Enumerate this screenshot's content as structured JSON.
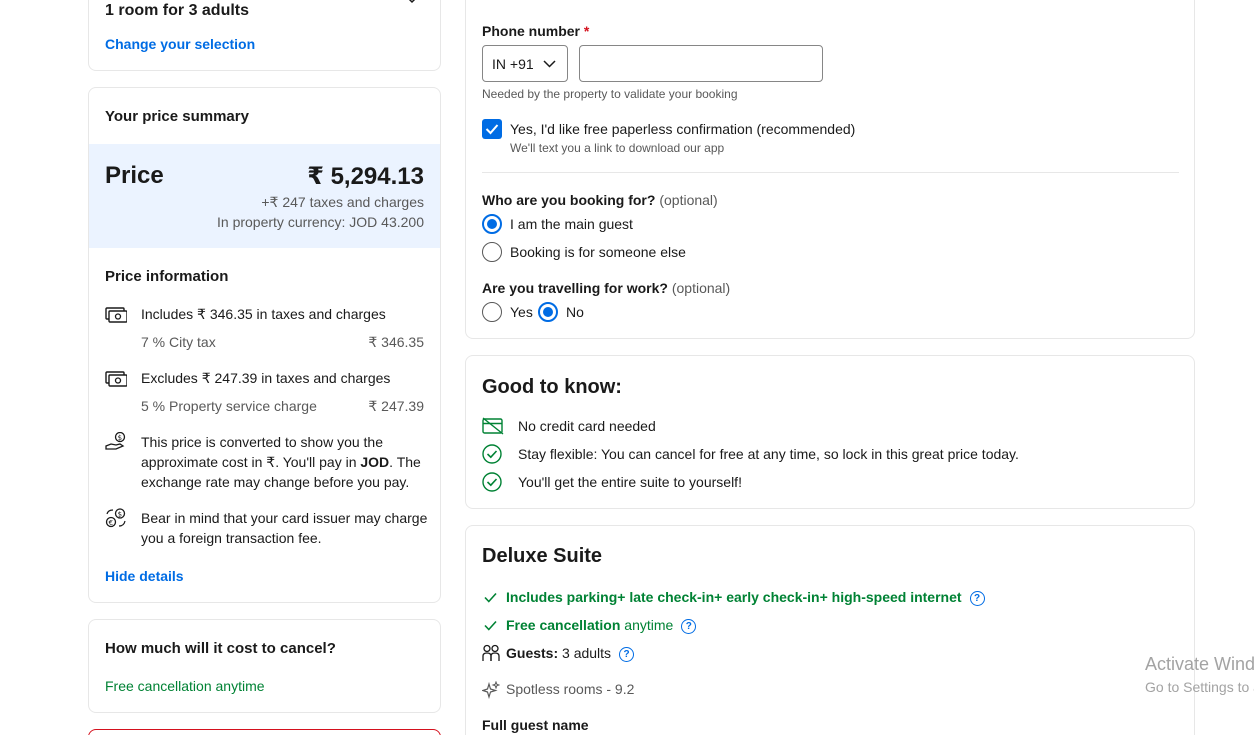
{
  "room_selection": {
    "title": "1 room for 3 adults",
    "change_link": "Change your selection"
  },
  "price_summary": {
    "heading": "Your price summary",
    "price_label": "Price",
    "price_value": "₹ 5,294.13",
    "taxes_line": "+₹ 247 taxes and charges",
    "property_currency": "In property currency: JOD 43.200"
  },
  "price_information": {
    "heading": "Price information",
    "includes_text": "Includes ₹ 346.35 in taxes and charges",
    "city_tax_label": "7 % City tax",
    "city_tax_value": "₹ 346.35",
    "excludes_text": "Excludes ₹ 247.39 in taxes and charges",
    "service_charge_label": "5 % Property service charge",
    "service_charge_value": "₹ 247.39",
    "converted_prefix": "This price is converted to show you the approximate cost in ₹. You'll pay in ",
    "converted_currency": "JOD",
    "converted_suffix": ". The exchange rate may change before you pay.",
    "card_fee_text": "Bear in mind that your card issuer may charge you a foreign transaction fee.",
    "hide_details": "Hide details"
  },
  "cancel_cost": {
    "heading": "How much will it cost to cancel?",
    "text": "Free cancellation anytime"
  },
  "form": {
    "phone_label": "Phone number",
    "required_mark": "*",
    "country_code": "IN +91",
    "phone_value": "",
    "phone_hint": "Needed by the property to validate your booking",
    "paperless_label": "Yes, I'd like free paperless confirmation (recommended)",
    "paperless_checked": true,
    "paperless_hint": "We'll text you a link to download our app",
    "booking_for_question": "Who are you booking for?",
    "booking_for_optional": "(optional)",
    "booking_for_options": [
      "I am the main guest",
      "Booking is for someone else"
    ],
    "booking_for_selected": "I am the main guest",
    "work_question": "Are you travelling for work?",
    "work_optional": "(optional)",
    "work_options": [
      "Yes",
      "No"
    ],
    "work_selected": "No"
  },
  "good_to_know": {
    "heading": "Good to know:",
    "items": [
      "No credit card needed",
      "Stay flexible: You can cancel for free at any time, so lock in this great price today.",
      "You'll get the entire suite to yourself!"
    ]
  },
  "suite": {
    "title": "Deluxe Suite",
    "includes": "Includes parking+ late check-in+ early check-in+ high-speed internet",
    "free_cancel": "Free cancellation",
    "free_cancel_suffix": "anytime",
    "guests_label": "Guests:",
    "guests_value": "3 adults",
    "spotless": "Spotless rooms - 9.2",
    "full_guest_name": "Full guest name"
  },
  "watermark": {
    "line1": "Activate Windows",
    "line2": "Go to Settings to activate Windows."
  },
  "colors": {
    "accent": "#006ce4",
    "green": "#008234",
    "price_band": "#ebf3ff",
    "required": "#d4111e"
  }
}
